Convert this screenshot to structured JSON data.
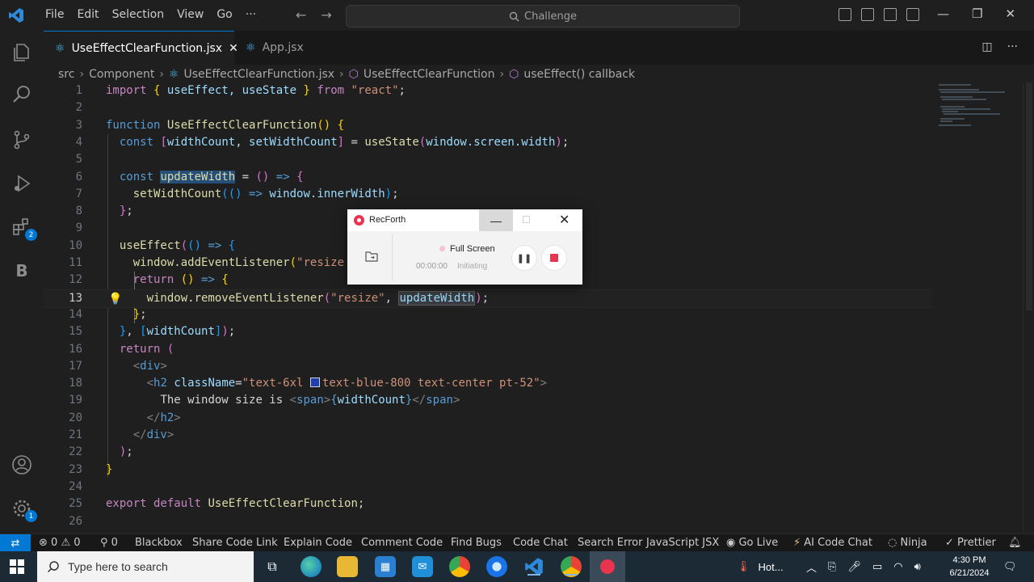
{
  "menu": [
    "File",
    "Edit",
    "Selection",
    "View",
    "Go",
    "···"
  ],
  "search": {
    "label": "Challenge"
  },
  "tabs": [
    {
      "label": "UseEffectClearFunction.jsx",
      "active": true
    },
    {
      "label": "App.jsx",
      "active": false
    }
  ],
  "breadcrumb": [
    "src",
    "Component",
    "UseEffectClearFunction.jsx",
    "UseEffectClearFunction",
    "useEffect() callback"
  ],
  "editor": {
    "line_numbers": [
      "1",
      "2",
      "3",
      "4",
      "5",
      "6",
      "7",
      "8",
      "9",
      "10",
      "11",
      "12",
      "13",
      "14",
      "15",
      "16",
      "17",
      "18",
      "19",
      "20",
      "21",
      "22",
      "23",
      "24",
      "25",
      "26"
    ],
    "current_line": "13",
    "text": {
      "l1_import": "import",
      "l1_names": " useEffect, useState ",
      "l1_from": "from",
      "l1_src": "\"react\"",
      "l3_function": "function",
      "l3_name": "UseEffectClearFunction",
      "l4_const": "const",
      "l4_a": "widthCount",
      "l4_b": "setWidthCount",
      "l4_c": "useState",
      "l4_d": "window.screen.width",
      "l6_const": "const",
      "l6_name": "updateWidth",
      "l7_fn": "setWidthCount",
      "l7_val": "window.innerWidth",
      "l10_fn": "useEffect",
      "l11_obj": "window.addEventListener",
      "l11_arg": "\"resize",
      "l12_return": "return",
      "l13_obj": "window.removeEventListener",
      "l13_arg": "\"resize\"",
      "l13_ref": "updateWidth",
      "l15_dep": "widthCount",
      "l16_return": "return",
      "l17_tag": "div",
      "l18_tag": "h2",
      "l18_attr": "className",
      "l18_val1": "\"text-6xl ",
      "l18_val2": "text-blue-800 text-center pt-52\"",
      "l19_text": "The window size is ",
      "l19_span": "span",
      "l19_var": "widthCount",
      "l20_tag": "h2",
      "l21_tag": "div",
      "l25_export": "export",
      "l25_default": "default",
      "l25_name": "UseEffectClearFunction"
    }
  },
  "recorder": {
    "title": "RecForth",
    "mode": "Full Screen",
    "time": "00:00:00",
    "status": "Initiating"
  },
  "activity_badges": {
    "extensions": "2",
    "settings": "1"
  },
  "statusbar": {
    "errors": "0",
    "warnings": "0",
    "ports": "0",
    "items": [
      "Blackbox",
      "Share Code Link",
      "Explain Code",
      "Comment Code",
      "Find Bugs",
      "Code Chat",
      "Search Error",
      "JavaScript JSX",
      "Go Live",
      "AI Code Chat",
      "Ninja",
      "Prettier"
    ]
  },
  "taskbar": {
    "search_placeholder": "Type here to search",
    "weather": "Hot...",
    "time": "4:30 PM",
    "date": "6/21/2024"
  },
  "colors": {
    "accent": "#0078d4",
    "editor_bg": "#1f1f1f",
    "recorder_red": "#e8344e"
  }
}
